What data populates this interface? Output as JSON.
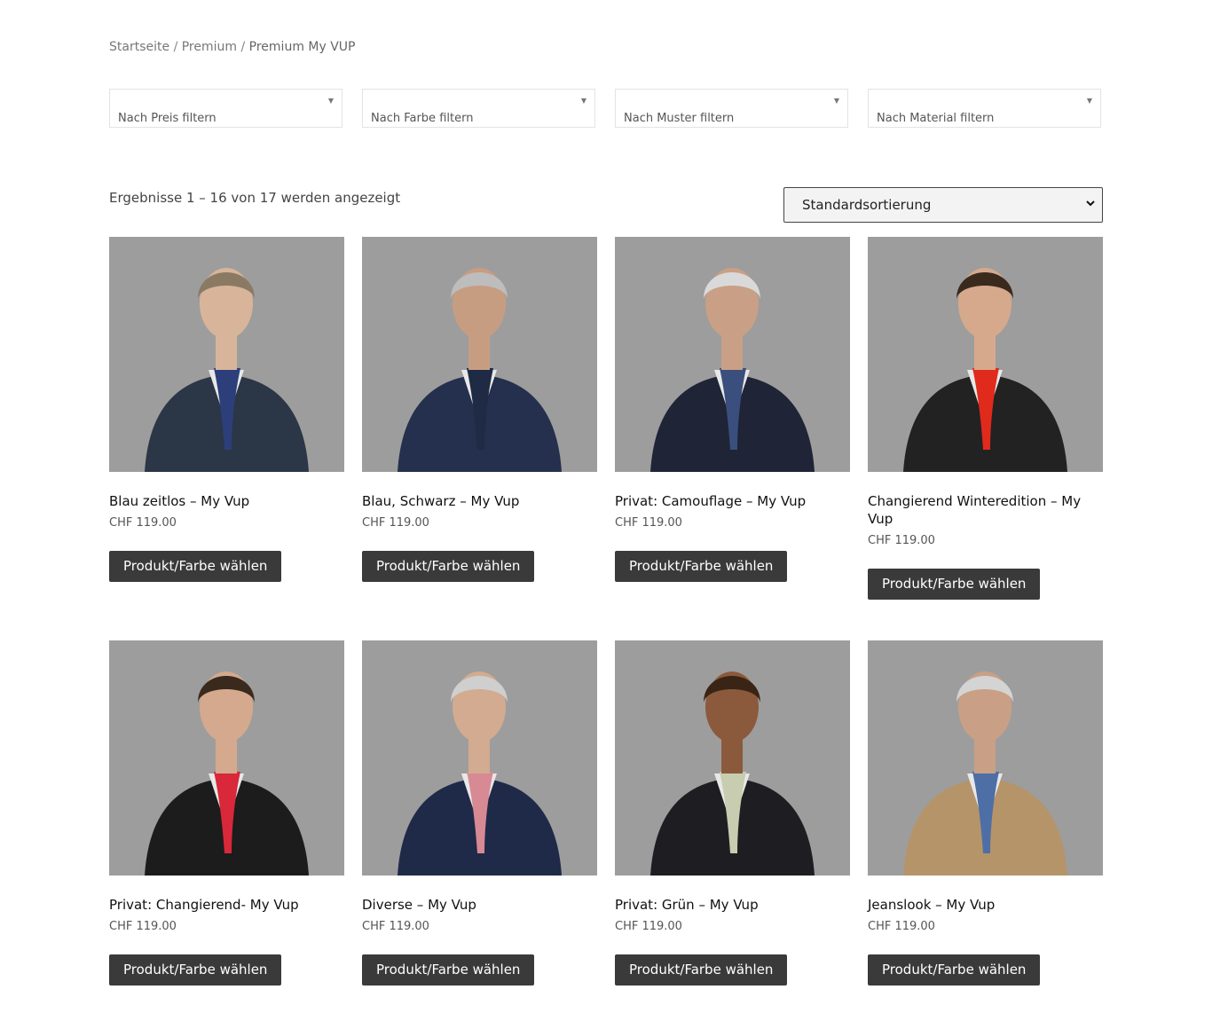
{
  "breadcrumb": {
    "home": "Startseite",
    "category": "Premium",
    "current": "Premium My VUP",
    "separator": "/"
  },
  "filters": [
    {
      "label": "Nach Preis filtern"
    },
    {
      "label": "Nach Farbe filtern"
    },
    {
      "label": "Nach Muster filtern"
    },
    {
      "label": "Nach Material filtern"
    }
  ],
  "result_count": "Ergebnisse 1 – 16 von 17 werden angezeigt",
  "sort": {
    "selected": "Standardsortierung"
  },
  "colors": {
    "button_bg": "#3a3a3a",
    "photo_bg": "#9d9d9d"
  },
  "products": [
    {
      "title": "Blau zeitlos – My Vup",
      "price": "CHF 119.00",
      "button": "Produkt/Farbe wählen",
      "scarf": "#2c3f7a",
      "jacket": "#2b3646",
      "hair": "#8a7a64",
      "skin": "#d8b59a"
    },
    {
      "title": "Blau, Schwarz – My Vup",
      "price": "CHF 119.00",
      "button": "Produkt/Farbe wählen",
      "scarf": "#1f2a44",
      "jacket": "#24304d",
      "hair": "#bdbdbd",
      "skin": "#c79d82"
    },
    {
      "title": "Privat: Camouflage – My Vup",
      "price": "CHF 119.00",
      "button": "Produkt/Farbe wählen",
      "scarf": "#3b4f7e",
      "jacket": "#1f2436",
      "hair": "#d9d9d9",
      "skin": "#c9a085"
    },
    {
      "title": "Changierend Winteredition – My Vup",
      "price": "CHF 119.00",
      "button": "Produkt/Farbe wählen",
      "scarf": "#e02a1c",
      "jacket": "#222222",
      "hair": "#3a2a1e",
      "skin": "#d6a98c"
    },
    {
      "title": "Privat: Changierend- My Vup",
      "price": "CHF 119.00",
      "button": "Produkt/Farbe wählen",
      "scarf": "#d8283a",
      "jacket": "#1c1c1c",
      "hair": "#3a2a1e",
      "skin": "#d4a98e"
    },
    {
      "title": "Diverse – My Vup",
      "price": "CHF 119.00",
      "button": "Produkt/Farbe wählen",
      "scarf": "#d88a94",
      "jacket": "#1f2a48",
      "hair": "#cfcfcf",
      "skin": "#d3ab90"
    },
    {
      "title": "Privat: Grün – My Vup",
      "price": "CHF 119.00",
      "button": "Produkt/Farbe wählen",
      "scarf": "#c8ccb0",
      "jacket": "#1e1e22",
      "hair": "#3a2416",
      "skin": "#8b5a3c"
    },
    {
      "title": "Jeanslook – My Vup",
      "price": "CHF 119.00",
      "button": "Produkt/Farbe wählen",
      "scarf": "#4e6ea6",
      "jacket": "#b59469",
      "hair": "#d4d4d4",
      "skin": "#c9a085"
    }
  ]
}
